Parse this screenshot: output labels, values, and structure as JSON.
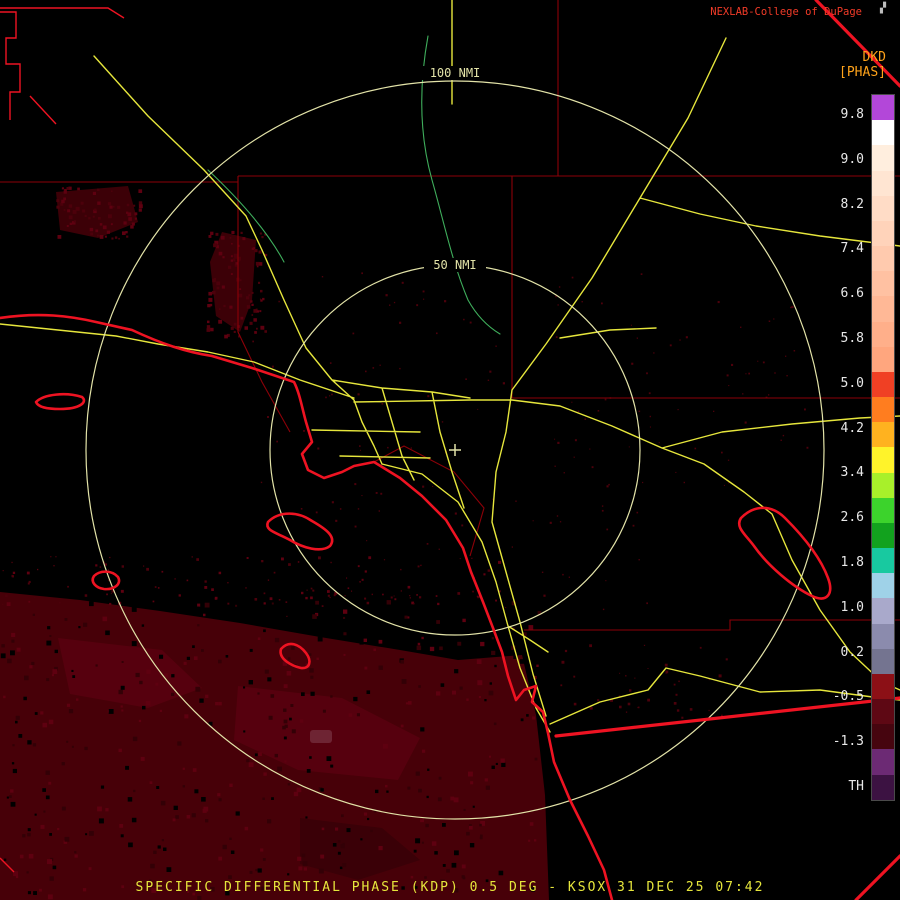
{
  "header": {
    "attribution": "NEXLAB-College of DuPage",
    "logo_glyph": "▞",
    "product_code": "DKD",
    "product_units": "[PHAS]"
  },
  "rings": {
    "outer_label": "100 NMI",
    "inner_label": "50 NMI"
  },
  "color_scale": {
    "labels": [
      "9.8",
      "9.0",
      "8.2",
      "7.4",
      "6.6",
      "5.8",
      "5.0",
      "4.2",
      "3.4",
      "2.6",
      "1.8",
      "1.0",
      "0.2",
      "-0.5",
      "-1.3",
      "TH"
    ],
    "segments": [
      "#b347d9",
      "#ffffff",
      "#ffeede",
      "#ffe5d2",
      "#ffdcc6",
      "#ffd3ba",
      "#ffcaae",
      "#ffc1a2",
      "#ffb896",
      "#ffaf8a",
      "#ffa67e",
      "#f04024",
      "#ff7d1f",
      "#ffb21f",
      "#fff32a",
      "#a8f02a",
      "#3cd32c",
      "#12a21e",
      "#18c9a0",
      "#9fd2e8",
      "#a9a9cb",
      "#8b8bad",
      "#747490",
      "#8c1016",
      "#5e0814",
      "#46050f",
      "#6c2a74",
      "#3c1242"
    ]
  },
  "footer": {
    "caption": "SPECIFIC DIFFERENTIAL PHASE (KDP) 0.5 DEG - KSOX 31 DEC 25 07:42"
  },
  "colors": {
    "background": "#000000",
    "attribution": "#f23b28",
    "product_label": "#ffa31a",
    "scale_label": "#e8e8e8",
    "range_ring": "#e3e3a8",
    "road": "#e6e63c",
    "river": "#3fae5c",
    "coastline": "#ee1322",
    "county_border": "#8c0008",
    "echo_fill": "#470008",
    "caption": "#e6e63c",
    "echo_variants": [
      "#5e0010",
      "#330006",
      "#000000",
      "#4c000b"
    ]
  }
}
